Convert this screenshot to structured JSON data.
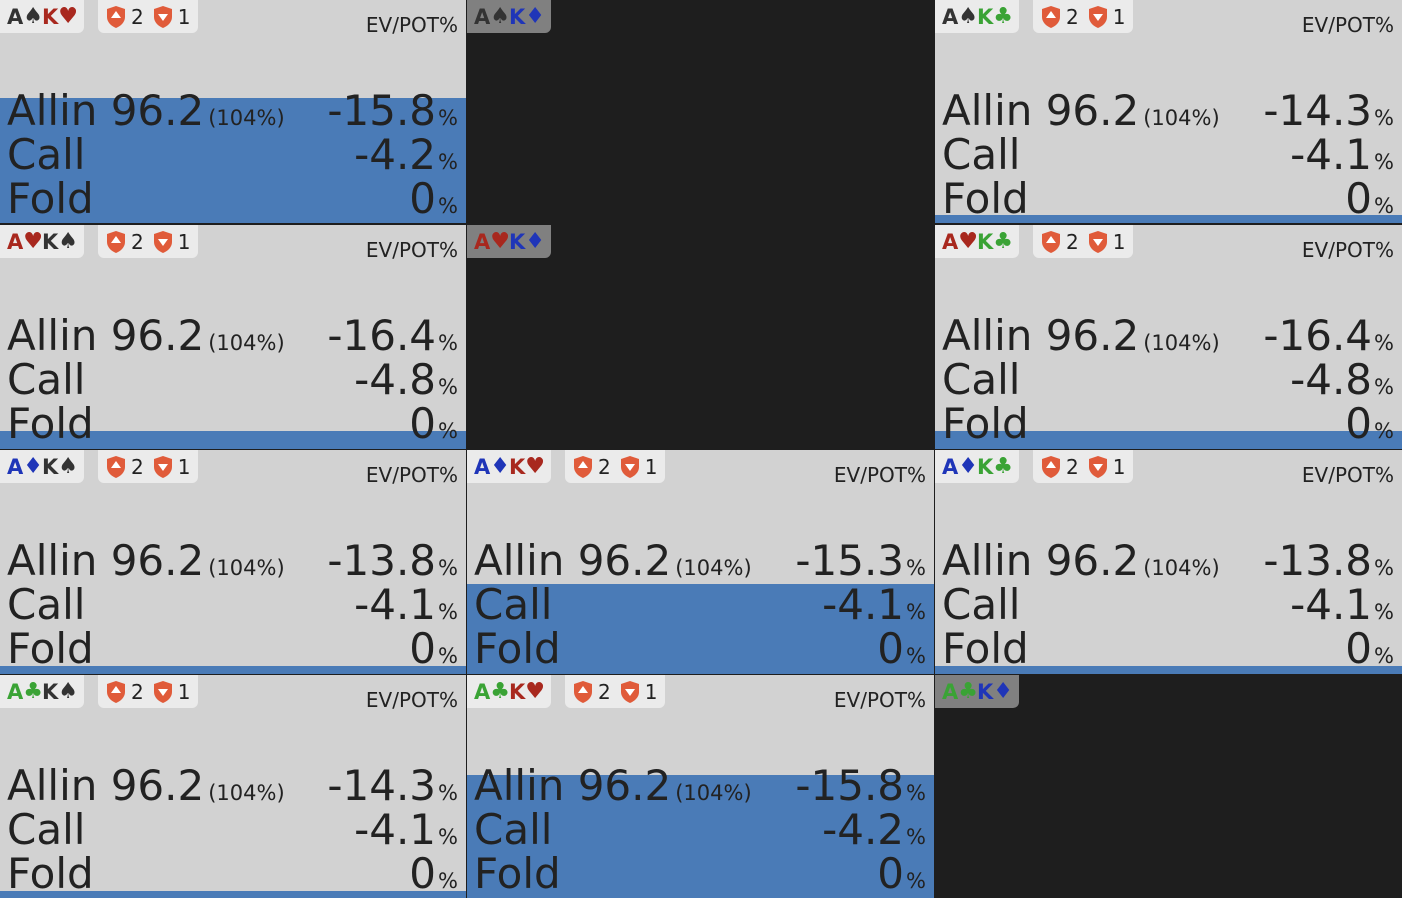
{
  "header_label": "EV/POT%",
  "badges": {
    "first": "2",
    "second": "1"
  },
  "colors": {
    "spade": "#333333",
    "heart": "#a8281e",
    "diamond": "#1f35b8",
    "club": "#3aa335",
    "dead_bg": "#1e1e1e",
    "live_bg": "#d2d2d2",
    "action_fill": "#4a7bb7",
    "badge_shield": "#e05b3a"
  },
  "cells": [
    {
      "hand": [
        {
          "rank": "A",
          "suit": "♠",
          "color": "spade"
        },
        {
          "rank": "K",
          "suit": "♥",
          "color": "heart"
        }
      ],
      "dead": false,
      "fill_fraction": 0.56,
      "actions": [
        {
          "name": "Allin 96.2",
          "sub": "(104%)",
          "ev": "-15.8",
          "pct": "%"
        },
        {
          "name": "Call",
          "sub": "",
          "ev": "-4.2",
          "pct": "%"
        },
        {
          "name": "Fold",
          "sub": "",
          "ev": "0",
          "pct": "%"
        }
      ]
    },
    {
      "hand": [
        {
          "rank": "A",
          "suit": "♠",
          "color": "spade"
        },
        {
          "rank": "K",
          "suit": "♦",
          "color": "diamond"
        }
      ],
      "dead": true
    },
    {
      "hand": [
        {
          "rank": "A",
          "suit": "♠",
          "color": "spade"
        },
        {
          "rank": "K",
          "suit": "♣",
          "color": "club"
        }
      ],
      "dead": false,
      "fill_fraction": 0.035,
      "actions": [
        {
          "name": "Allin 96.2",
          "sub": "(104%)",
          "ev": "-14.3",
          "pct": "%"
        },
        {
          "name": "Call",
          "sub": "",
          "ev": "-4.1",
          "pct": "%"
        },
        {
          "name": "Fold",
          "sub": "",
          "ev": "0",
          "pct": "%"
        }
      ]
    },
    {
      "hand": [
        {
          "rank": "A",
          "suit": "♥",
          "color": "heart"
        },
        {
          "rank": "K",
          "suit": "♠",
          "color": "spade"
        }
      ],
      "dead": false,
      "fill_fraction": 0.08,
      "actions": [
        {
          "name": "Allin 96.2",
          "sub": "(104%)",
          "ev": "-16.4",
          "pct": "%"
        },
        {
          "name": "Call",
          "sub": "",
          "ev": "-4.8",
          "pct": "%"
        },
        {
          "name": "Fold",
          "sub": "",
          "ev": "0",
          "pct": "%"
        }
      ]
    },
    {
      "hand": [
        {
          "rank": "A",
          "suit": "♥",
          "color": "heart"
        },
        {
          "rank": "K",
          "suit": "♦",
          "color": "diamond"
        }
      ],
      "dead": true
    },
    {
      "hand": [
        {
          "rank": "A",
          "suit": "♥",
          "color": "heart"
        },
        {
          "rank": "K",
          "suit": "♣",
          "color": "club"
        }
      ],
      "dead": false,
      "fill_fraction": 0.08,
      "actions": [
        {
          "name": "Allin 96.2",
          "sub": "(104%)",
          "ev": "-16.4",
          "pct": "%"
        },
        {
          "name": "Call",
          "sub": "",
          "ev": "-4.8",
          "pct": "%"
        },
        {
          "name": "Fold",
          "sub": "",
          "ev": "0",
          "pct": "%"
        }
      ]
    },
    {
      "hand": [
        {
          "rank": "A",
          "suit": "♦",
          "color": "diamond"
        },
        {
          "rank": "K",
          "suit": "♠",
          "color": "spade"
        }
      ],
      "dead": false,
      "fill_fraction": 0.035,
      "actions": [
        {
          "name": "Allin 96.2",
          "sub": "(104%)",
          "ev": "-13.8",
          "pct": "%"
        },
        {
          "name": "Call",
          "sub": "",
          "ev": "-4.1",
          "pct": "%"
        },
        {
          "name": "Fold",
          "sub": "",
          "ev": "0",
          "pct": "%"
        }
      ]
    },
    {
      "hand": [
        {
          "rank": "A",
          "suit": "♦",
          "color": "diamond"
        },
        {
          "rank": "K",
          "suit": "♥",
          "color": "heart"
        }
      ],
      "dead": false,
      "fill_fraction": 0.4,
      "actions": [
        {
          "name": "Allin 96.2",
          "sub": "(104%)",
          "ev": "-15.3",
          "pct": "%"
        },
        {
          "name": "Call",
          "sub": "",
          "ev": "-4.1",
          "pct": "%"
        },
        {
          "name": "Fold",
          "sub": "",
          "ev": "0",
          "pct": "%"
        }
      ]
    },
    {
      "hand": [
        {
          "rank": "A",
          "suit": "♦",
          "color": "diamond"
        },
        {
          "rank": "K",
          "suit": "♣",
          "color": "club"
        }
      ],
      "dead": false,
      "fill_fraction": 0.035,
      "actions": [
        {
          "name": "Allin 96.2",
          "sub": "(104%)",
          "ev": "-13.8",
          "pct": "%"
        },
        {
          "name": "Call",
          "sub": "",
          "ev": "-4.1",
          "pct": "%"
        },
        {
          "name": "Fold",
          "sub": "",
          "ev": "0",
          "pct": "%"
        }
      ]
    },
    {
      "hand": [
        {
          "rank": "A",
          "suit": "♣",
          "color": "club"
        },
        {
          "rank": "K",
          "suit": "♠",
          "color": "spade"
        }
      ],
      "dead": false,
      "fill_fraction": 0.03,
      "actions": [
        {
          "name": "Allin 96.2",
          "sub": "(104%)",
          "ev": "-14.3",
          "pct": "%"
        },
        {
          "name": "Call",
          "sub": "",
          "ev": "-4.1",
          "pct": "%"
        },
        {
          "name": "Fold",
          "sub": "",
          "ev": "0",
          "pct": "%"
        }
      ]
    },
    {
      "hand": [
        {
          "rank": "A",
          "suit": "♣",
          "color": "club"
        },
        {
          "rank": "K",
          "suit": "♥",
          "color": "heart"
        }
      ],
      "dead": false,
      "fill_fraction": 0.55,
      "actions": [
        {
          "name": "Allin 96.2",
          "sub": "(104%)",
          "ev": "-15.8",
          "pct": "%"
        },
        {
          "name": "Call",
          "sub": "",
          "ev": "-4.2",
          "pct": "%"
        },
        {
          "name": "Fold",
          "sub": "",
          "ev": "0",
          "pct": "%"
        }
      ]
    },
    {
      "hand": [
        {
          "rank": "A",
          "suit": "♣",
          "color": "club"
        },
        {
          "rank": "K",
          "suit": "♦",
          "color": "diamond"
        }
      ],
      "dead": true
    }
  ]
}
